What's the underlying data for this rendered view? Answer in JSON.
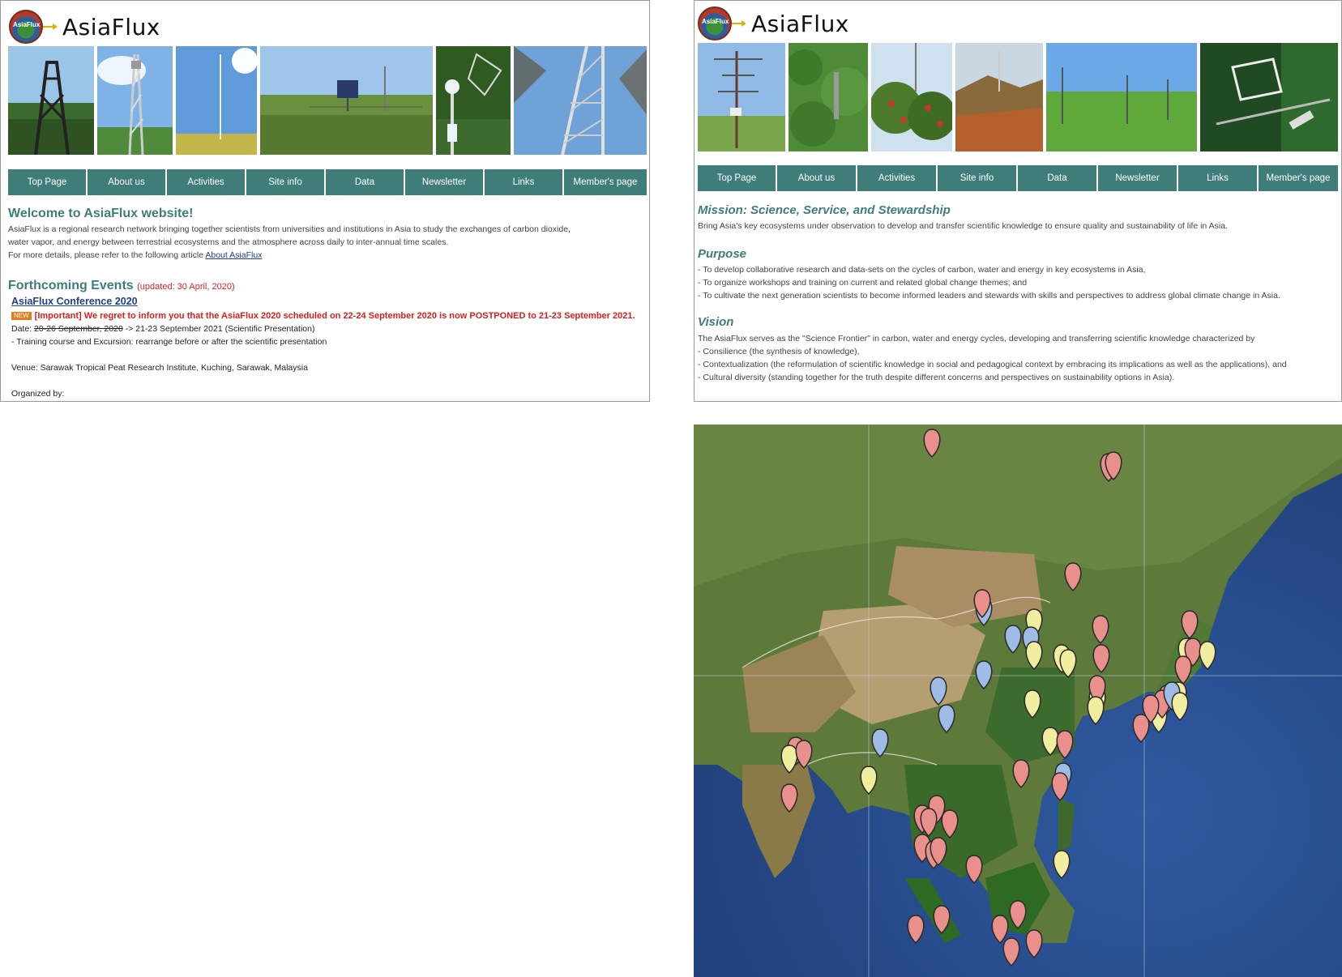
{
  "left": {
    "logo_text": "AsiaFlux",
    "logo_tag": "AsiaFlux",
    "nav": [
      "Top Page",
      "About us",
      "Activities",
      "Site info",
      "Data",
      "Newsletter",
      "Links",
      "Member's page"
    ],
    "welcome_title": "Welcome to AsiaFlux website!",
    "welcome_lines": [
      "AsiaFlux is a regional research network bringing together scientists from universities and institutions in Asia to study the exchanges of carbon dioxide,",
      "water vapor, and energy between terrestrial ecosystems and the atmosphere across daily to inter-annual time scales."
    ],
    "more_details": "For more details, please refer to the following article",
    "about_link": "About AsiaFlux",
    "events_title": "Forthcoming Events",
    "events_updated": "(updated: 30 April, 2020)",
    "conference_link": "AsiaFlux Conference 2020",
    "new_badge": "NEW",
    "important_notice": "[Important] We regret to inform you that the AsiaFlux 2020 scheduled on 22-24 September 2020 is now POSTPONED to 21-23 September 2021.",
    "date_label": "Date:",
    "date_old": "20-26 September, 2020",
    "date_new": "-> 21-23 September 2021 (Scientific Presentation)",
    "training": "- Training course and Excursion: rearrange before or after the scientific presentation",
    "venue": "Venue: Sarawak Tropical Peat Research Institute, Kuching, Sarawak, Malaysia",
    "organized_by": "Organized by:"
  },
  "right": {
    "logo_text": "AsiaFlux",
    "logo_tag": "AsiaFlux",
    "nav": [
      "Top Page",
      "About us",
      "Activities",
      "Site info",
      "Data",
      "Newsletter",
      "Links",
      "Member's page"
    ],
    "mission_title": "Mission: Science, Service, and Stewardship",
    "mission_text": "Bring Asia's key ecosystems under observation to develop and transfer scientific knowledge to ensure quality and sustainability of life in Asia.",
    "purpose_title": "Purpose",
    "purpose_items": [
      "- To develop collaborative research and data-sets on the cycles of carbon, water and energy in key ecosystems in Asia,",
      "- To organize workshops and training on current and related global change themes; and",
      "- To cultivate the next generation scientists to become informed leaders and stewards with skills and perspectives to address global climate change in Asia."
    ],
    "vision_title": "Vision",
    "vision_items": [
      "The AsiaFlux serves as the \"Science Frontier\" in carbon, water and energy cycles, developing and transferring scientific knowledge characterized by",
      "- Consilience (the synthesis of knowledge),",
      "- Contextualization (the reformulation of scientific knowledge in social and pedagogical context by embracing its implications as well as the applications), and",
      "- Cultural diversity (standing together for the truth despite different concerns and perspectives on sustainability options in Asia)."
    ]
  },
  "colors": {
    "accent_teal": "#3f7d7b",
    "alert_red": "#e01b1b",
    "link_blue": "#1f3f8f",
    "marker_red": "#e9908c",
    "marker_blue": "#9fbce6",
    "marker_yellow": "#f2eea0"
  }
}
